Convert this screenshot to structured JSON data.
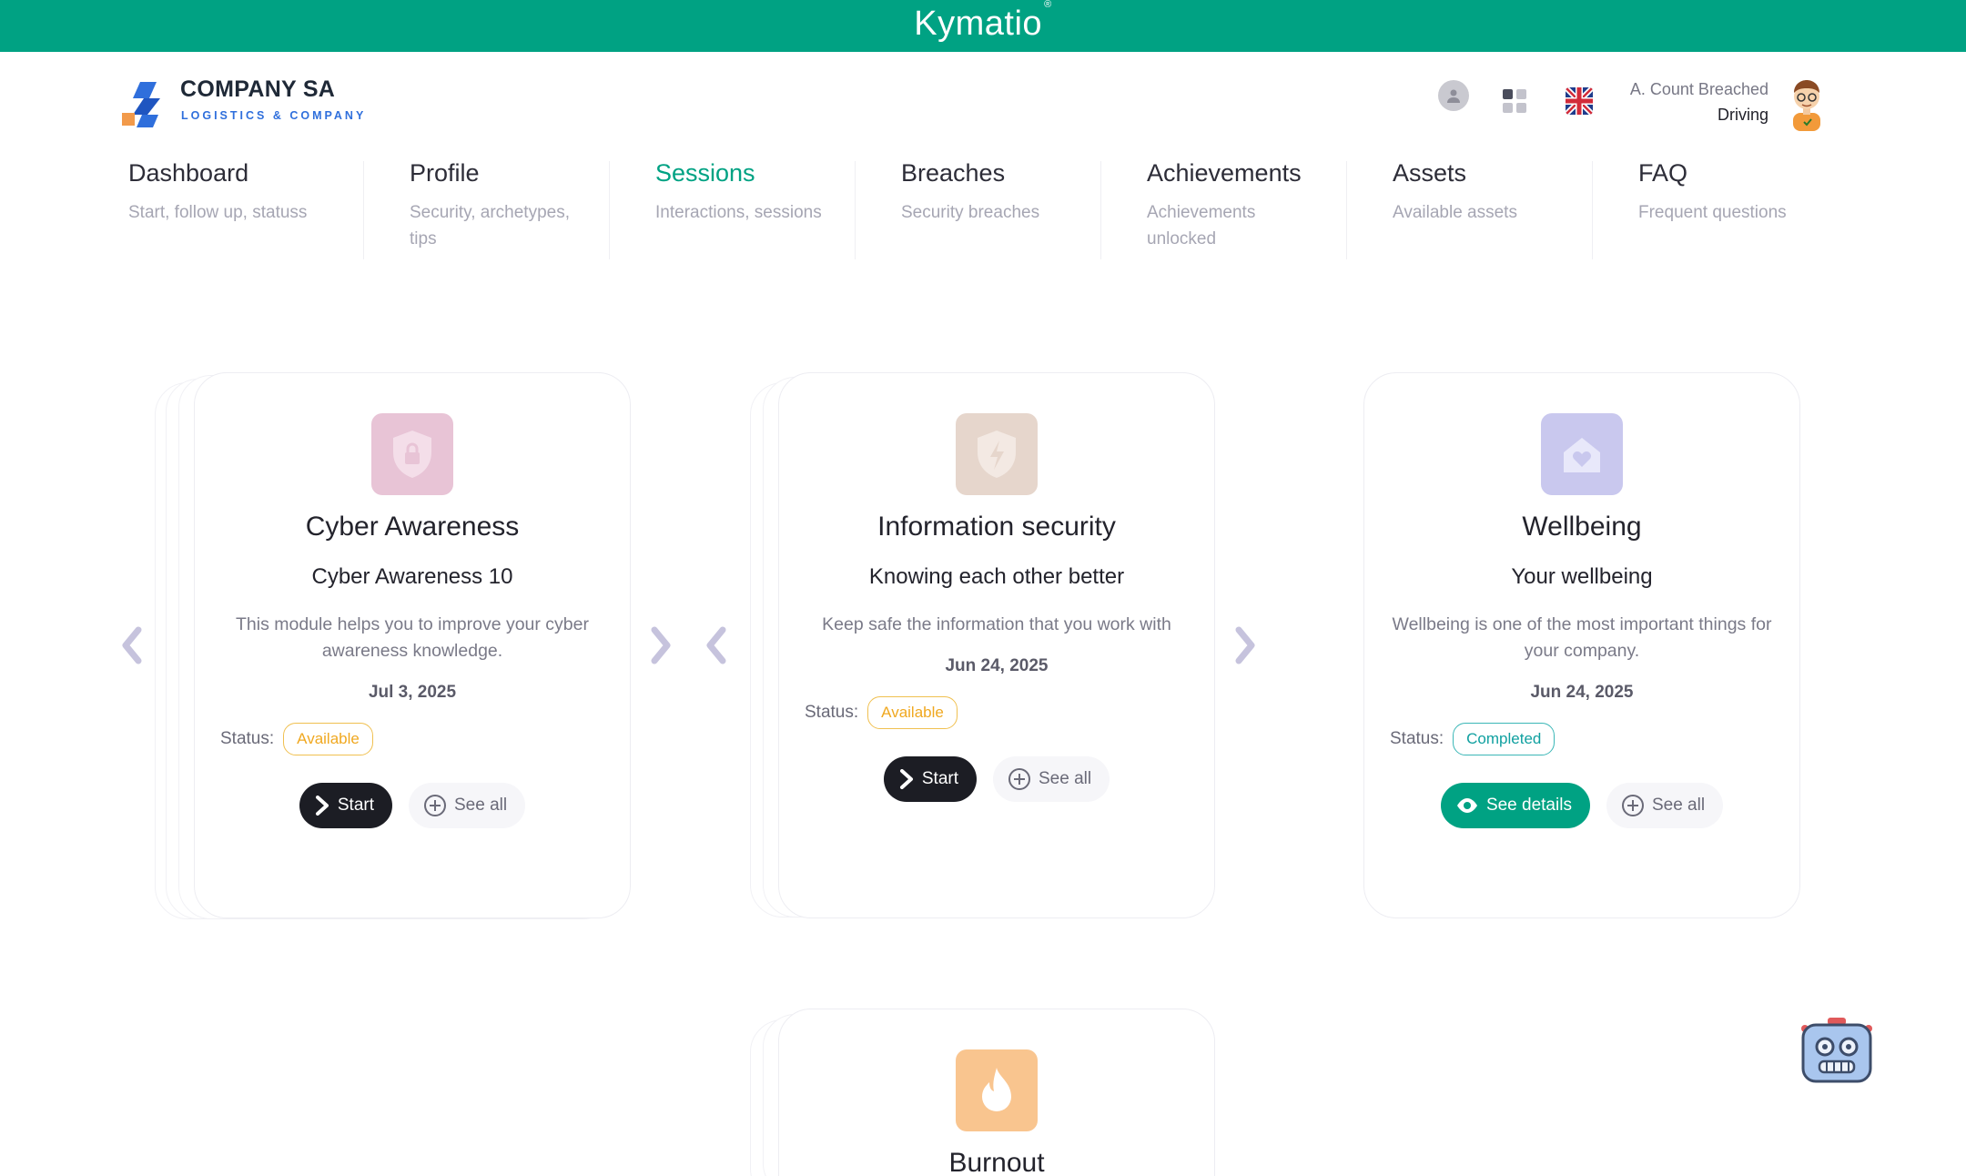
{
  "topbar": {
    "brand": "Kymatio",
    "reg": "®"
  },
  "company": {
    "name": "COMPANY SA",
    "tagline": "LOGISTICS & COMPANY"
  },
  "user": {
    "name": "A. Count Breached",
    "role": "Driving"
  },
  "nav": [
    {
      "title": "Dashboard",
      "subtitle": "Start, follow up, statuss"
    },
    {
      "title": "Profile",
      "subtitle": "Security, archetypes, tips"
    },
    {
      "title": "Sessions",
      "subtitle": "Interactions, sessions"
    },
    {
      "title": "Breaches",
      "subtitle": "Security breaches"
    },
    {
      "title": "Achievements",
      "subtitle": "Achievements unlocked"
    },
    {
      "title": "Assets",
      "subtitle": "Available assets"
    },
    {
      "title": "FAQ",
      "subtitle": "Frequent questions"
    }
  ],
  "cards": [
    {
      "category": "Cyber Awareness",
      "module": "Cyber Awareness 10",
      "description": "This module helps you to improve your cyber awareness knowledge.",
      "date": "Jul 3, 2025",
      "status_label": "Status:",
      "status": "Available",
      "primary": "Start",
      "secondary": "See all",
      "icon": "shield-lock-icon",
      "color": "#e8c4d6"
    },
    {
      "category": "Information security",
      "module": "Knowing each other better",
      "description": "Keep safe the information that you work with",
      "date": "Jun 24, 2025",
      "status_label": "Status:",
      "status": "Available",
      "primary": "Start",
      "secondary": "See all",
      "icon": "shield-bolt-icon",
      "color": "#e6d6cc"
    },
    {
      "category": "Wellbeing",
      "module": "Your wellbeing",
      "description": "Wellbeing is one of the most important things for your company.",
      "date": "Jun 24, 2025",
      "status_label": "Status:",
      "status": "Completed",
      "primary": "See details",
      "secondary": "See all",
      "icon": "house-heart-icon",
      "color": "#c9c8ee"
    },
    {
      "category": "Burnout",
      "icon": "flame-icon",
      "color": "#f9c58f"
    }
  ],
  "colors": {
    "brand": "#00a283",
    "dark": "#1c1d24",
    "available": "#f0a820",
    "completed": "#10a0a0"
  }
}
